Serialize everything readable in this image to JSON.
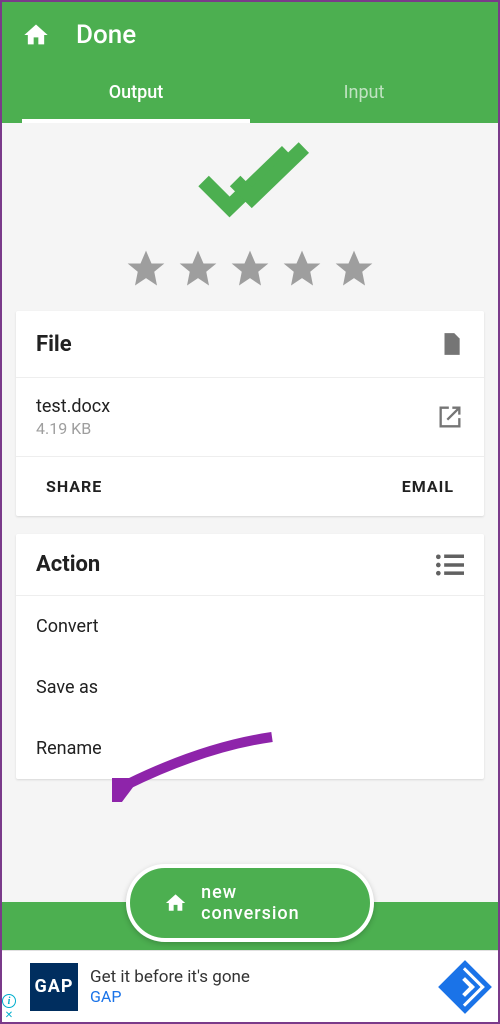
{
  "header": {
    "title": "Done"
  },
  "tabs": {
    "output": "Output",
    "input": "Input"
  },
  "file": {
    "heading": "File",
    "name": "test.docx",
    "size": "4.19 KB",
    "share": "SHARE",
    "email": "EMAIL"
  },
  "action": {
    "heading": "Action",
    "convert": "Convert",
    "saveas": "Save as",
    "rename": "Rename"
  },
  "fab": {
    "label": "new conversion"
  },
  "ad": {
    "logo": "GAP",
    "headline": "Get it before it's gone",
    "sub": "GAP"
  }
}
